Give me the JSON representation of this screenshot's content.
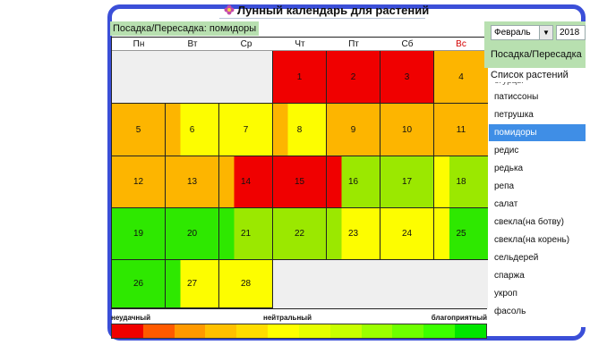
{
  "window": {
    "title": "Лунный календарь для растений",
    "subtitle": "Посадка/Пересадка: помидоры"
  },
  "controls": {
    "month": "Февраль",
    "year": "2018",
    "mode": "Посадка/Пересадка"
  },
  "weekdays": [
    "Пн",
    "Вт",
    "Ср",
    "Чт",
    "Пт",
    "Сб",
    "Вс"
  ],
  "colors": {
    "red": "#f00000",
    "orange": "#fdb500",
    "yellow": "#fdfd00",
    "lightgreen": "#9be800",
    "green": "#2ee800",
    "blank": "#efefef",
    "selection": "#3f8ee6",
    "frame": "#3b4fd8"
  },
  "days": [
    {
      "day": "1",
      "color": "#f00000",
      "accent": null
    },
    {
      "day": "2",
      "color": "#f00000",
      "accent": null
    },
    {
      "day": "3",
      "color": "#f00000",
      "accent": null
    },
    {
      "day": "4",
      "color": "#fdb500",
      "accent": null
    },
    {
      "day": "5",
      "color": "#fdb500",
      "accent": null
    },
    {
      "day": "6",
      "color": "#fdfd00",
      "accent": "#fdb500"
    },
    {
      "day": "7",
      "color": "#fdfd00",
      "accent": null
    },
    {
      "day": "8",
      "color": "#fdfd00",
      "accent": "#fdb500"
    },
    {
      "day": "9",
      "color": "#fdb500",
      "accent": null
    },
    {
      "day": "10",
      "color": "#fdb500",
      "accent": null
    },
    {
      "day": "11",
      "color": "#fdb500",
      "accent": null
    },
    {
      "day": "12",
      "color": "#fdb500",
      "accent": null
    },
    {
      "day": "13",
      "color": "#fdb500",
      "accent": null
    },
    {
      "day": "14",
      "color": "#f00000",
      "accent": "#fdb500"
    },
    {
      "day": "15",
      "color": "#f00000",
      "accent": null
    },
    {
      "day": "16",
      "color": "#9be800",
      "accent": "#f00000"
    },
    {
      "day": "17",
      "color": "#9be800",
      "accent": null
    },
    {
      "day": "18",
      "color": "#9be800",
      "accent": "#fdfd00"
    },
    {
      "day": "19",
      "color": "#2ee800",
      "accent": null
    },
    {
      "day": "20",
      "color": "#2ee800",
      "accent": null
    },
    {
      "day": "21",
      "color": "#9be800",
      "accent": "#2ee800"
    },
    {
      "day": "22",
      "color": "#9be800",
      "accent": null
    },
    {
      "day": "23",
      "color": "#fdfd00",
      "accent": "#9be800"
    },
    {
      "day": "24",
      "color": "#fdfd00",
      "accent": null
    },
    {
      "day": "25",
      "color": "#2ee800",
      "accent": "#fdfd00"
    },
    {
      "day": "26",
      "color": "#2ee800",
      "accent": null
    },
    {
      "day": "27",
      "color": "#fdfd00",
      "accent": "#2ee800"
    },
    {
      "day": "28",
      "color": "#fdfd00",
      "accent": null
    }
  ],
  "legend": {
    "bad": "неудачный",
    "neutral": "нейтральный",
    "good": "благоприятный",
    "scale": [
      "#f00000",
      "#ff5a00",
      "#ff9900",
      "#ffc000",
      "#ffdc00",
      "#ffff00",
      "#e6ff00",
      "#c8ff00",
      "#9bff00",
      "#6eff00",
      "#3cff00",
      "#00e600"
    ]
  },
  "plants": {
    "header": "Список растений",
    "partial_item": "огурцы",
    "selected": "помидоры",
    "items": [
      "патиссоны",
      "петрушка",
      "помидоры",
      "редис",
      "редька",
      "репа",
      "салат",
      "свекла(на ботву)",
      "свекла(на корень)",
      "сельдерей",
      "спаржа",
      "укроп",
      "фасоль"
    ]
  }
}
